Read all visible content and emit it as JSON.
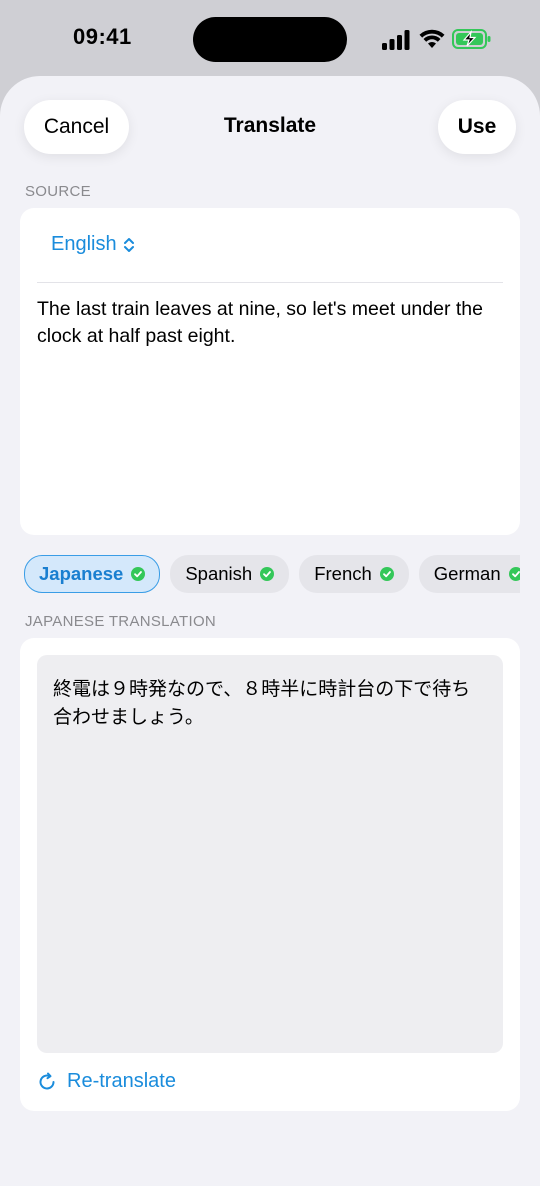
{
  "status_bar": {
    "time": "09:41"
  },
  "nav": {
    "cancel_label": "Cancel",
    "title": "Translate",
    "use_label": "Use"
  },
  "source": {
    "section_label": "SOURCE",
    "language": "English",
    "text": "The last train leaves at nine, so let's meet under the clock at half past eight."
  },
  "target_languages": [
    {
      "label": "Japanese",
      "selected": true,
      "done": true
    },
    {
      "label": "Spanish",
      "selected": false,
      "done": true
    },
    {
      "label": "French",
      "selected": false,
      "done": true
    },
    {
      "label": "German",
      "selected": false,
      "done": true
    }
  ],
  "translation": {
    "section_label": "JAPANESE TRANSLATION",
    "text": "終電は９時発なので、８時半に時計台の下で待ち合わせましょう。",
    "retranslate_label": "Re-translate"
  },
  "colors": {
    "accent": "#1a8cdc",
    "success": "#34c759",
    "sheet_bg": "#f2f2f7"
  }
}
